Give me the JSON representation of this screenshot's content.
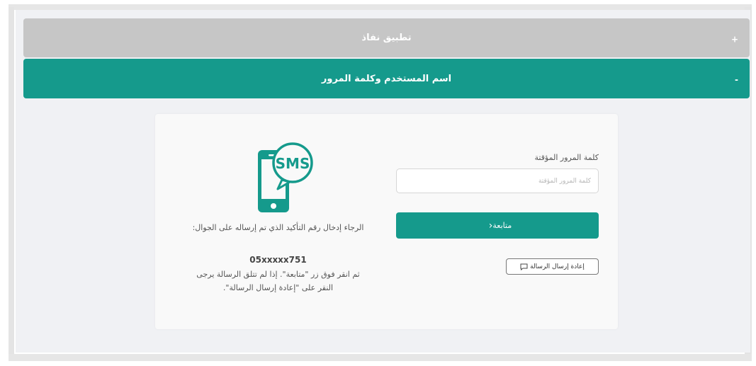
{
  "accordion": {
    "section1": {
      "title": "تطبيق نفاذ",
      "sign": "+"
    },
    "section2": {
      "title": "اسم المستخدم وكلمة المرور",
      "sign": "-"
    }
  },
  "form": {
    "password_label": "كلمة المرور المؤقتة",
    "password_placeholder": "كلمة المرور المؤقتة",
    "continue_label": "متابعة",
    "resend_label": "إعادة إرسال الرسالة"
  },
  "info": {
    "sms_text": "SMS",
    "message_line1": "الرجاء إدخال رقم التأكيد الذي تم إرساله على الجوال:",
    "phone_number": "05xxxxx751",
    "message_line2": "ثم انقر فوق زر \"متابعة\". إذا لم تتلق الرسالة يرجى النقر على \"إعادة إرسال الرسالة\"."
  },
  "colors": {
    "primary": "#159a8c",
    "collapsed_header": "#c6c6c6",
    "background": "#f0f1f4"
  }
}
